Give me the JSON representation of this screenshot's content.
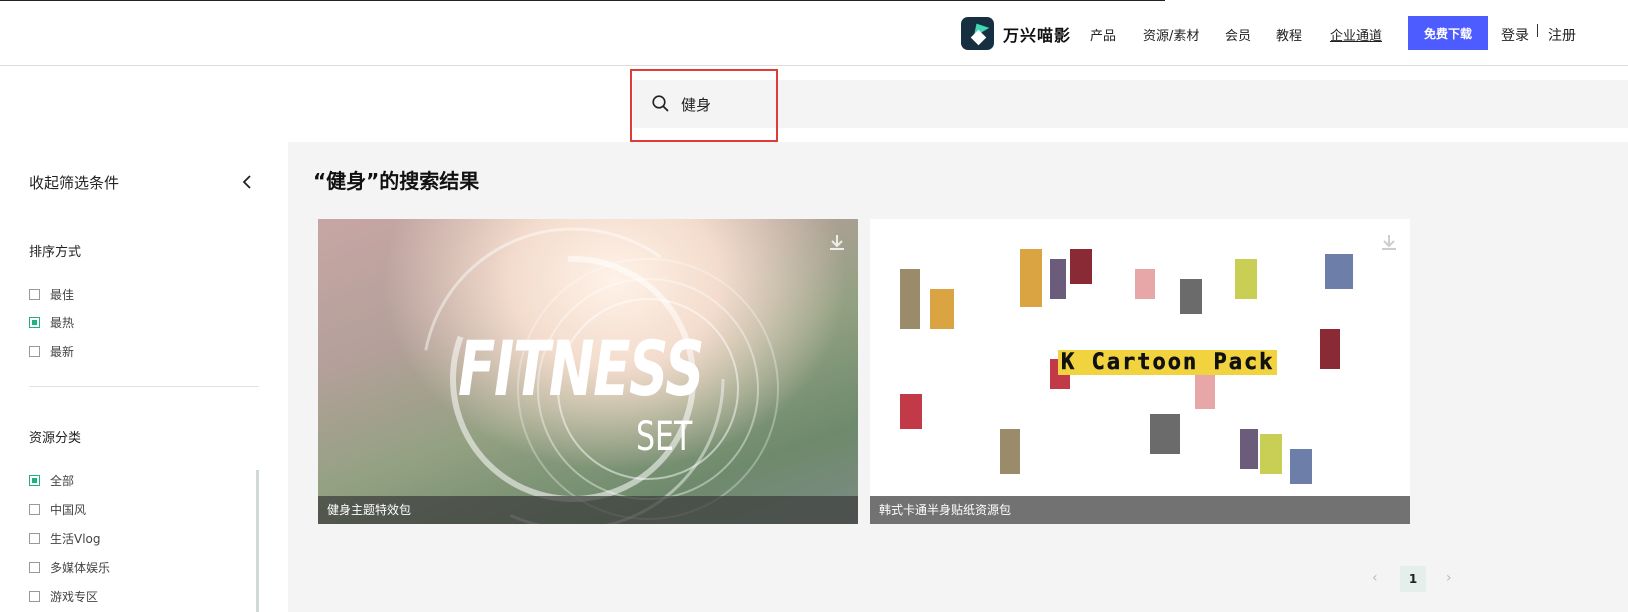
{
  "header": {
    "brand_name": "万兴喵影",
    "nav": [
      "产品",
      "资源/素材",
      "会员",
      "教程",
      "企业通道"
    ],
    "download_label": "免费下载",
    "login_label": "登录",
    "register_label": "注册"
  },
  "search": {
    "value": "健身"
  },
  "sidebar": {
    "collapse_label": "收起筛选条件",
    "sort_title": "排序方式",
    "sort_options": [
      {
        "label": "最佳",
        "checked": false
      },
      {
        "label": "最热",
        "checked": true
      },
      {
        "label": "最新",
        "checked": false
      }
    ],
    "category_title": "资源分类",
    "category_options": [
      {
        "label": "全部",
        "checked": true
      },
      {
        "label": "中国风",
        "checked": false
      },
      {
        "label": "生活Vlog",
        "checked": false
      },
      {
        "label": "多媒体娱乐",
        "checked": false
      },
      {
        "label": "游戏专区",
        "checked": false
      }
    ]
  },
  "results": {
    "title": "“健身”的搜索结果",
    "cards": [
      {
        "caption": "健身主题特效包",
        "thumb_title": "FITNESS",
        "thumb_subtitle": "SET"
      },
      {
        "caption": "韩式卡通半身贴纸资源包",
        "thumb_title": "K Cartoon Pack"
      }
    ]
  },
  "pagination": {
    "prev": "‹",
    "current": "1",
    "next": "›"
  },
  "colors": {
    "accent": "#4d5cff",
    "check": "#22b07d",
    "annotation": "#e03a3a"
  }
}
